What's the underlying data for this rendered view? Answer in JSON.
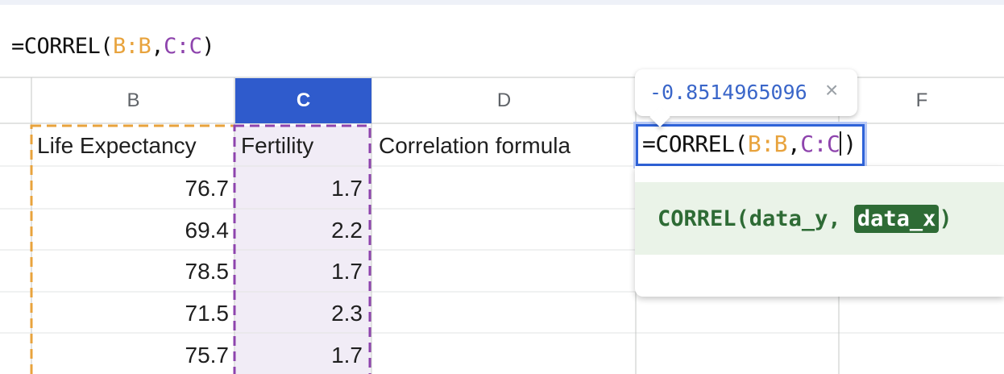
{
  "formula_bar": {
    "prefix": "=CORREL(",
    "ref_b": "B:B",
    "comma": ",",
    "ref_c": "C:C",
    "suffix": ")"
  },
  "columns": [
    {
      "label": "B",
      "selected": false
    },
    {
      "label": "C",
      "selected": true
    },
    {
      "label": "D",
      "selected": false
    },
    {
      "label": "F",
      "selected": false
    }
  ],
  "headers_row": {
    "b": "Life Expectancy",
    "c": "Fertility",
    "d": "Correlation formula"
  },
  "rows": [
    {
      "b": "76.7",
      "c": "1.7"
    },
    {
      "b": "69.4",
      "c": "2.2"
    },
    {
      "b": "78.5",
      "c": "1.7"
    },
    {
      "b": "71.5",
      "c": "2.3"
    },
    {
      "b": "75.7",
      "c": "1.7"
    }
  ],
  "editing_cell": {
    "prefix": "=CORREL(",
    "ref_b": "B:B",
    "comma": ",",
    "ref_c": "C:C",
    "suffix": ")"
  },
  "result_tooltip": {
    "value": "-0.8514965096",
    "close_glyph": "×"
  },
  "function_help": {
    "name": "CORREL(",
    "arg1": "data_y, ",
    "arg2": "data_x",
    "close": ")"
  },
  "colors": {
    "selected_column": "#2f5bcc",
    "ref_b": "#e8a33d",
    "ref_c": "#8e44ad",
    "edit_border": "#2f63d9",
    "help_active": "#2e6b35"
  }
}
